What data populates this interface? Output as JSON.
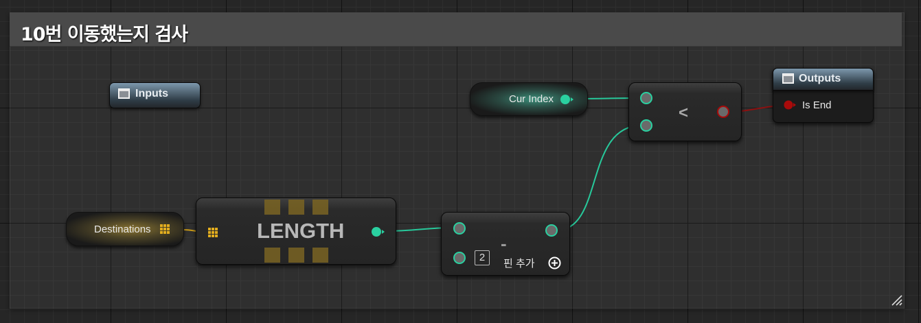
{
  "comment": {
    "title": "10번 이동했는지 검사"
  },
  "tunnels": {
    "inputs_title": "Inputs",
    "outputs_title": "Outputs",
    "outputs_pin_label": "Is End"
  },
  "variables": {
    "cur_index_label": "Cur Index",
    "destinations_label": "Destinations"
  },
  "length_node": {
    "title": "LENGTH"
  },
  "subtract_node": {
    "symbol": "-",
    "pin_index": "2",
    "add_pin_label": "핀 추가"
  },
  "less_node": {
    "symbol": "<"
  },
  "colors": {
    "int_pin": "#2ad0a0",
    "bool_pin": "#a80a0a",
    "struct_array_pin": "#e2ad1e",
    "wire_int": "#27c99b",
    "wire_bool": "#8d1111",
    "wire_array": "#c99a18"
  },
  "icons": {
    "array_pin": "array-grid-icon",
    "add_pin": "plus-circle-icon",
    "tunnel": "tunnel-window-icon",
    "resize": "resize-grip-icon"
  }
}
